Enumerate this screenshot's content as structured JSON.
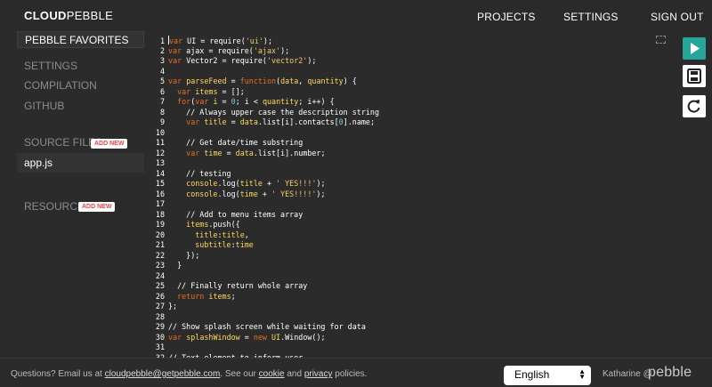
{
  "header": {
    "logo_bold": "CLOUD",
    "logo_light": "PEBBLE",
    "nav": [
      "PROJECTS",
      "SETTINGS",
      "SIGN OUT"
    ]
  },
  "sidebar": {
    "favorites_label": "PEBBLE FAVORITES",
    "items": [
      "SETTINGS",
      "COMPILATION",
      "GITHUB"
    ],
    "source_files_label": "SOURCE FILES",
    "add_new_label": "ADD NEW",
    "files": [
      "app.js"
    ],
    "resources_label": "RESOURCES"
  },
  "editor": {
    "lines": [
      {
        "n": "1",
        "html": "<span class=\"cursor\"></span><span class=\"kw\">var</span> UI = require(<span class=\"str\">'ui'</span>);"
      },
      {
        "n": "2",
        "html": "<span class=\"kw\">var</span> ajax = require(<span class=\"str\">'ajax'</span>);"
      },
      {
        "n": "3",
        "html": "<span class=\"kw\">var</span> Vector2 = require(<span class=\"str\">'vector2'</span>);"
      },
      {
        "n": "4",
        "html": ""
      },
      {
        "n": "5",
        "html": "<span class=\"kw\">var</span> <span class=\"id\">parseFeed</span> = <span class=\"kw\">function</span>(<span class=\"id\">data</span>, <span class=\"id\">quantity</span>) {"
      },
      {
        "n": "6",
        "html": "  <span class=\"kw\">var</span> <span class=\"id\">items</span> = [];"
      },
      {
        "n": "7",
        "html": "  <span class=\"kw\">for</span>(<span class=\"kw\">var</span> <span class=\"id\">i</span> = <span class=\"num\">0</span>; i &lt; <span class=\"id\">quantity</span>; i++) {"
      },
      {
        "n": "8",
        "html": "    // Always upper case the description string"
      },
      {
        "n": "9",
        "html": "    <span class=\"kw\">var</span> <span class=\"id\">title</span> = <span class=\"id\">data</span>.list[i].contacts[<span class=\"num\">0</span>].name;"
      },
      {
        "n": "10",
        "html": ""
      },
      {
        "n": "11",
        "html": "    // Get date/time substring"
      },
      {
        "n": "12",
        "html": "    <span class=\"kw\">var</span> <span class=\"id\">time</span> = <span class=\"id\">data</span>.list[i].number;"
      },
      {
        "n": "13",
        "html": ""
      },
      {
        "n": "14",
        "html": "    // testing"
      },
      {
        "n": "15",
        "html": "    <span class=\"id\">console</span>.log(<span class=\"id\">title</span> + <span class=\"str\">' YES!!!'</span>);"
      },
      {
        "n": "16",
        "html": "    <span class=\"id\">console</span>.log(<span class=\"id\">time</span> + <span class=\"str\">' YES!!!!'</span>);"
      },
      {
        "n": "17",
        "html": ""
      },
      {
        "n": "18",
        "html": "    // Add to menu items array"
      },
      {
        "n": "19",
        "html": "    <span class=\"id\">items</span>.push({"
      },
      {
        "n": "20",
        "html": "      <span class=\"id\">title</span>:<span class=\"id\">title</span>,"
      },
      {
        "n": "21",
        "html": "      <span class=\"id\">subtitle</span>:<span class=\"id\">time</span>"
      },
      {
        "n": "22",
        "html": "    });"
      },
      {
        "n": "23",
        "html": "  }"
      },
      {
        "n": "24",
        "html": ""
      },
      {
        "n": "25",
        "html": "  // Finally return whole array"
      },
      {
        "n": "26",
        "html": "  <span class=\"kw\">return</span> <span class=\"id\">items</span>;"
      },
      {
        "n": "27",
        "html": "};"
      },
      {
        "n": "28",
        "html": ""
      },
      {
        "n": "29",
        "html": "// Show splash screen while waiting for data"
      },
      {
        "n": "30",
        "html": "<span class=\"kw\">var</span> <span class=\"id\">splashWindow</span> = <span class=\"kw\">new</span> <span class=\"id\">UI</span>.Window();"
      },
      {
        "n": "31",
        "html": ""
      },
      {
        "n": "32",
        "html": "// Text element to inform user"
      }
    ]
  },
  "footer": {
    "text_1": "Questions? Email us at ",
    "email": "cloudpebble@getpebble.com",
    "text_2": ". See our ",
    "cookie": "cookie",
    "text_3": " and ",
    "privacy": "privacy",
    "text_4": " policies.",
    "language": "English",
    "user": "Katharine @",
    "brand": "pebble"
  },
  "colors": {
    "run_button": "#26a69a",
    "keyword": "#e8701e",
    "string": "#f5c76a",
    "add_new_text": "#ee4444"
  },
  "icons": [
    "play-icon",
    "save-icon",
    "reload-icon",
    "fullscreen-icon"
  ]
}
